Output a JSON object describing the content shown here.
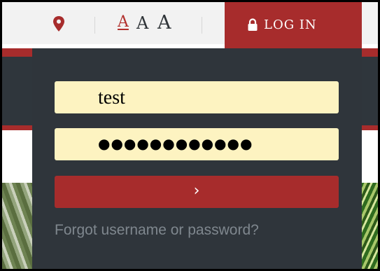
{
  "header": {
    "location_icon": "map-pin-icon",
    "font_size_options": [
      "A",
      "A",
      "A"
    ],
    "login_tab": {
      "icon": "lock-icon",
      "label": "LOG IN"
    }
  },
  "login_form": {
    "username_value": "test",
    "password_masked": "●●●●●●●●●●●●",
    "submit_icon": "chevron-right-icon",
    "submit_glyph": "›",
    "forgot_link": "Forgot username or password?"
  },
  "colors": {
    "brand_red": "#a72c2c",
    "panel_dark": "#2f353b",
    "field_bg": "#fdf3c1",
    "link_gray": "#7f878e"
  }
}
